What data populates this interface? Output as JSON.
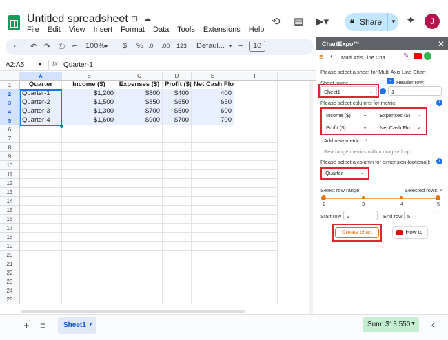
{
  "app": {
    "title": "Untitled spreadsheet",
    "menu": [
      "File",
      "Edit",
      "View",
      "Insert",
      "Format",
      "Data",
      "Tools",
      "Extensions",
      "Help"
    ],
    "share_label": "Share",
    "avatar_letter": "J"
  },
  "toolbar": {
    "zoom": "100%",
    "currency": "$",
    "percent": "%",
    "decimals_dec": ".0",
    "decimals_inc": ".00",
    "num_format": "123",
    "font": "Defaul...",
    "font_size": "10"
  },
  "formula_bar": {
    "name_box": "A2:A5",
    "fx": "fx",
    "value": "Quarter-1"
  },
  "grid": {
    "columns": [
      "A",
      "B",
      "C",
      "D",
      "E",
      "F"
    ],
    "rows": [
      "1",
      "2",
      "3",
      "4",
      "5",
      "6",
      "7",
      "8",
      "9",
      "10",
      "11",
      "12",
      "13",
      "14",
      "15",
      "16",
      "17",
      "18",
      "19",
      "20",
      "21",
      "22",
      "23",
      "24",
      "25"
    ],
    "data": [
      [
        "Quarter",
        "Income ($)",
        "Expenses ($)",
        "Profit ($)",
        "Net Cash Flow ($)"
      ],
      [
        "Quarter-1",
        "$1,200",
        "$800",
        "$400",
        "400"
      ],
      [
        "Quarter-2",
        "$1,500",
        "$850",
        "$650",
        "650"
      ],
      [
        "Quarter-3",
        "$1,300",
        "$700",
        "$600",
        "600"
      ],
      [
        "Quarter-4",
        "$1,600",
        "$900",
        "$700",
        "700"
      ]
    ]
  },
  "bottom": {
    "add": "+",
    "list": "≡",
    "sheet_tab": "Sheet1",
    "sum": "Sum: $13,550"
  },
  "sidebar": {
    "title": "ChartExpo™",
    "chart_name": "Multi Axis Line Cha...",
    "heading": "Please select a sheet for Multi Axis Line Chart",
    "sheet_name_label": "Sheet name:",
    "header_row_label": "Header row:",
    "sheet_value": "Sheet1",
    "header_row_value": "1",
    "metric_label": "Please select columns for metric:",
    "metrics": [
      "Income ($)",
      "Expenses ($)",
      "Profit ($)",
      "Net Cash Flo..."
    ],
    "add_metric": "Add new metric",
    "rearrange": "Rearrange metrics with a drag-n-drop.",
    "dimension_label": "Please select a column for dimension (optional):",
    "dimension_value": "Quarter",
    "row_range_label": "Select row range:",
    "selected_rows": "Selected rows: 4",
    "ticks": [
      "2",
      "3",
      "4",
      "5"
    ],
    "start_row_label": "Start row",
    "start_row": "2",
    "end_row_label": "End row",
    "end_row": "5",
    "create_chart": "Create chart",
    "how_to": "How to"
  },
  "colors": {
    "accent": "#d9282f",
    "orange": "#e8710a",
    "share_bg": "#c2e7ff",
    "sheet_green": "#0f9d58"
  }
}
